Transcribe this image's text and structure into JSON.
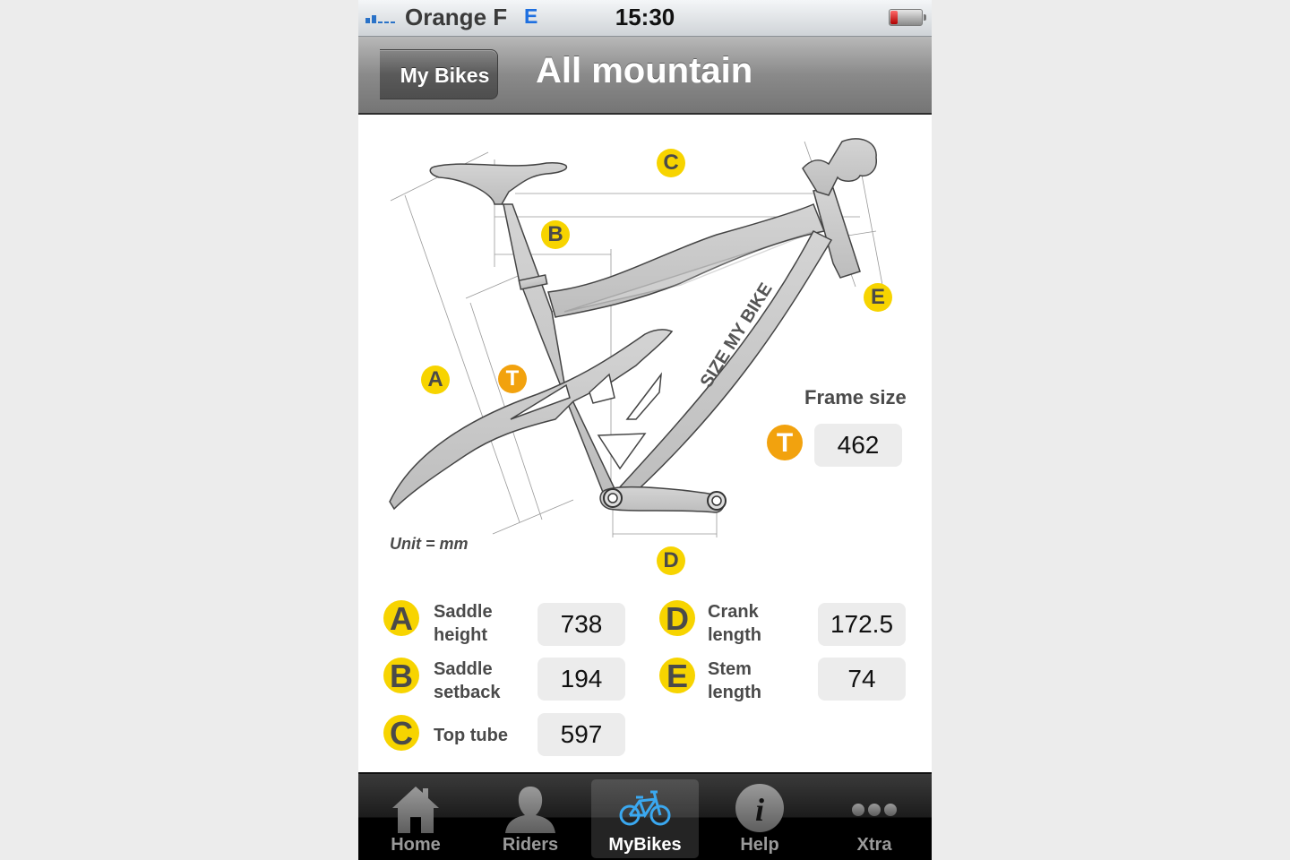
{
  "status_bar": {
    "carrier": "Orange F",
    "network": "E",
    "time": "15:30",
    "signal_bars": 2,
    "signal_max": 5,
    "battery_level": 0.2
  },
  "nav": {
    "back_label": "My Bikes",
    "title": "All mountain"
  },
  "diagram": {
    "brand_text": "SIZE MY BIKE",
    "unit_label": "Unit = mm",
    "markers": [
      "A",
      "B",
      "C",
      "D",
      "E",
      "T"
    ]
  },
  "frame_size": {
    "label": "Frame size",
    "badge": "T",
    "value": "462"
  },
  "measurements": [
    {
      "badge": "A",
      "label_line1": "Saddle",
      "label_line2": "height",
      "value": "738"
    },
    {
      "badge": "B",
      "label_line1": "Saddle",
      "label_line2": "setback",
      "value": "194"
    },
    {
      "badge": "C",
      "label_line1": "Top tube",
      "label_line2": "",
      "value": "597"
    },
    {
      "badge": "D",
      "label_line1": "Crank",
      "label_line2": "length",
      "value": "172.5"
    },
    {
      "badge": "E",
      "label_line1": "Stem",
      "label_line2": "length",
      "value": "74"
    }
  ],
  "tabs": [
    {
      "label": "Home",
      "icon": "home-icon",
      "active": false
    },
    {
      "label": "Riders",
      "icon": "person-icon",
      "active": false
    },
    {
      "label": "MyBikes",
      "icon": "bicycle-icon",
      "active": true
    },
    {
      "label": "Help",
      "icon": "info-icon",
      "active": false
    },
    {
      "label": "Xtra",
      "icon": "more-icon",
      "active": false
    }
  ],
  "colors": {
    "badge_yellow": "#f7d400",
    "badge_orange": "#f2a20e",
    "active_tab_icon": "#3aa8f0"
  }
}
